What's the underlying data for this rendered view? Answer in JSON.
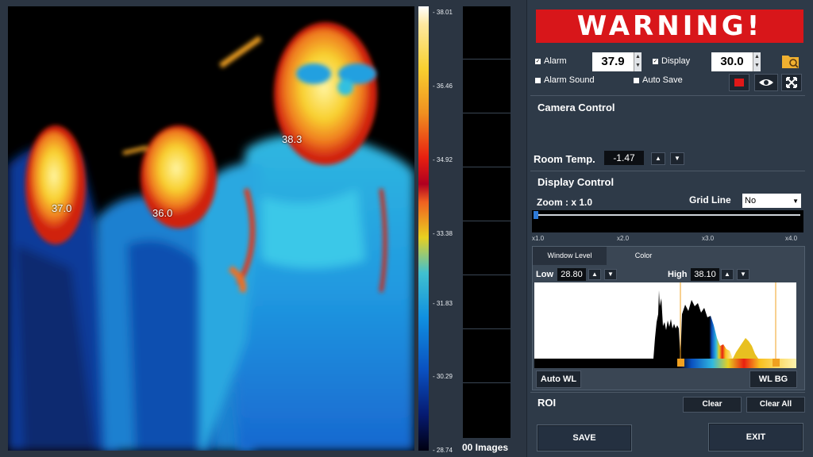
{
  "colors": {
    "warning_bg": "#d8161a",
    "panel_bg": "#2e3a48",
    "accent_orange": "#f0a020"
  },
  "thermal": {
    "labels": [
      {
        "text": "37.0"
      },
      {
        "text": "36.0"
      },
      {
        "text": "38.3"
      }
    ]
  },
  "scale": {
    "ticks": [
      "- 38.01",
      "- 36.46",
      "- 34.92",
      "- 33.38",
      "- 31.83",
      "- 30.29",
      "- 28.74"
    ]
  },
  "thumbs": {
    "label": "00 Images"
  },
  "warning": {
    "text": "WARNING!"
  },
  "alarm": {
    "alarm_label": "Alarm",
    "alarm_value": "37.9",
    "display_label": "Display",
    "display_value": "30.0",
    "sound_label": "Alarm Sound",
    "autosave_label": "Auto Save",
    "icons": [
      "folder-search-icon",
      "record-icon",
      "eye-icon",
      "fullscreen-icon"
    ]
  },
  "camera": {
    "title": "Camera Control",
    "room_label": "Room Temp.",
    "room_value": "-1.47"
  },
  "display": {
    "title": "Display Control",
    "zoom_label": "Zoom : x 1.0",
    "grid_label": "Grid Line",
    "grid_value": "No",
    "zoom_ticks": [
      "x1.0",
      "x2.0",
      "x3.0",
      "x4.0"
    ],
    "zoom_level": 0
  },
  "histogram": {
    "tabs": [
      {
        "label": "Window Level"
      },
      {
        "label": "Color"
      }
    ],
    "low_label": "Low",
    "low_value": "28.80",
    "high_label": "High",
    "high_value": "38.10",
    "auto_wl": "Auto WL",
    "wl_bg": "WL BG"
  },
  "roi": {
    "title": "ROI",
    "clear": "Clear",
    "clear_all": "Clear All"
  },
  "actions": {
    "save": "SAVE",
    "exit": "EXIT"
  }
}
